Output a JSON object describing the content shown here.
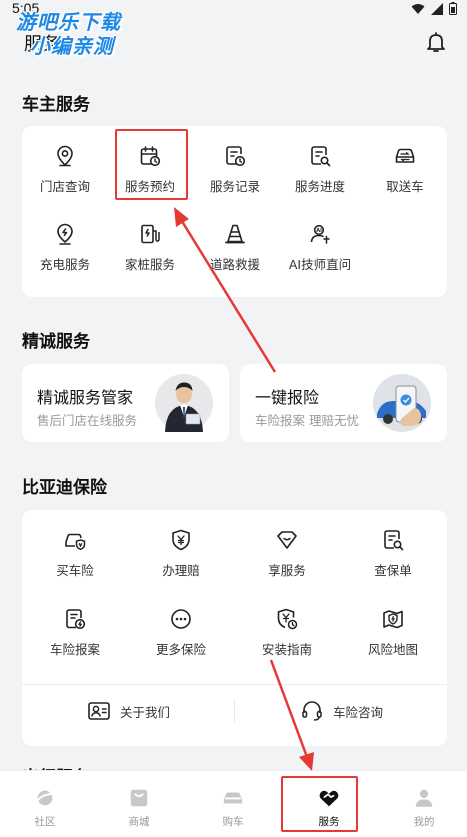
{
  "status_bar": {
    "time": "5:05"
  },
  "watermark": {
    "line1": "游吧乐下载",
    "line2": "小编亲测"
  },
  "header": {
    "title": "服务"
  },
  "owner_services": {
    "title": "车主服务",
    "items": [
      {
        "label": "门店查询",
        "icon": "location-pin-icon"
      },
      {
        "label": "服务预约",
        "icon": "calendar-clock-icon"
      },
      {
        "label": "服务记录",
        "icon": "record-clock-icon"
      },
      {
        "label": "服务进度",
        "icon": "progress-search-icon"
      },
      {
        "label": "取送车",
        "icon": "car-exchange-icon"
      },
      {
        "label": "充电服务",
        "icon": "charging-pin-icon"
      },
      {
        "label": "家桩服务",
        "icon": "charging-pile-icon"
      },
      {
        "label": "道路救援",
        "icon": "traffic-cone-icon"
      },
      {
        "label": "AI技师直问",
        "icon": "ai-technician-icon"
      }
    ]
  },
  "premium_services": {
    "title": "精诚服务",
    "cards": [
      {
        "title": "精诚服务管家",
        "subtitle": "售后门店在线服务"
      },
      {
        "title": "一键报险",
        "subtitle": "车险报案 理赔无忧"
      }
    ]
  },
  "insurance": {
    "title": "比亚迪保险",
    "items": [
      {
        "label": "买车险",
        "icon": "car-shield-icon"
      },
      {
        "label": "办理赔",
        "icon": "yuan-shield-icon"
      },
      {
        "label": "享服务",
        "icon": "diamond-icon"
      },
      {
        "label": "查保单",
        "icon": "policy-search-icon"
      },
      {
        "label": "车险报案",
        "icon": "report-document-icon"
      },
      {
        "label": "更多保险",
        "icon": "more-dots-icon"
      },
      {
        "label": "安装指南",
        "icon": "guide-shield-icon"
      },
      {
        "label": "风险地图",
        "icon": "risk-map-icon"
      }
    ],
    "footer": [
      {
        "label": "关于我们",
        "icon": "about-us-icon"
      },
      {
        "label": "车险咨询",
        "icon": "headset-icon"
      }
    ]
  },
  "partial_section": {
    "title": "出行服务"
  },
  "bottom_nav": {
    "items": [
      {
        "label": "社区",
        "icon": "planet-icon",
        "active": false
      },
      {
        "label": "商城",
        "icon": "shopping-bag-icon",
        "active": false
      },
      {
        "label": "购车",
        "icon": "car-icon",
        "active": false
      },
      {
        "label": "服务",
        "icon": "heart-handshake-icon",
        "active": true
      },
      {
        "label": "我的",
        "icon": "person-icon",
        "active": false
      }
    ]
  },
  "colors": {
    "accent": "#111111",
    "annotation": "#e53935",
    "watermark": "#1e88e5"
  }
}
